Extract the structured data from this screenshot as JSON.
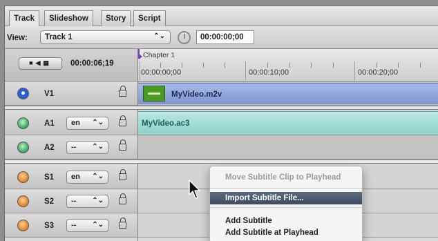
{
  "tabs": [
    "Track",
    "Slideshow",
    "Story",
    "Script"
  ],
  "view": {
    "label": "View:",
    "selected": "Track 1",
    "timecode": "00:00:00;00",
    "select_arrows": "⌃⌄"
  },
  "header": {
    "current_timecode": "00:00:06;19",
    "transport_glyphs": "■◀▦"
  },
  "ruler": {
    "chapter": "Chapter 1",
    "ticks": [
      "00:00:00;00",
      "00:00:10;00",
      "00:00:20;00"
    ]
  },
  "tracks": {
    "v1": {
      "name": "V1",
      "clip": "MyVideo.m2v"
    },
    "a1": {
      "name": "A1",
      "lang": "en",
      "clip": "MyVideo.ac3"
    },
    "a2": {
      "name": "A2",
      "lang": "--"
    },
    "s1": {
      "name": "S1",
      "lang": "en"
    },
    "s2": {
      "name": "S2",
      "lang": "--"
    },
    "s3": {
      "name": "S3",
      "lang": "--"
    }
  },
  "context_menu": {
    "items": [
      "Move Subtitle Clip to Playhead",
      "Import Subtitle File...",
      "Add Subtitle",
      "Add Subtitle at Playhead"
    ],
    "disabled_index": 0,
    "highlighted_index": 1
  },
  "colors": {
    "video_clip": "#8fa3da",
    "audio_clip": "#a5ddd6",
    "menu_highlight": "#4a576d"
  }
}
